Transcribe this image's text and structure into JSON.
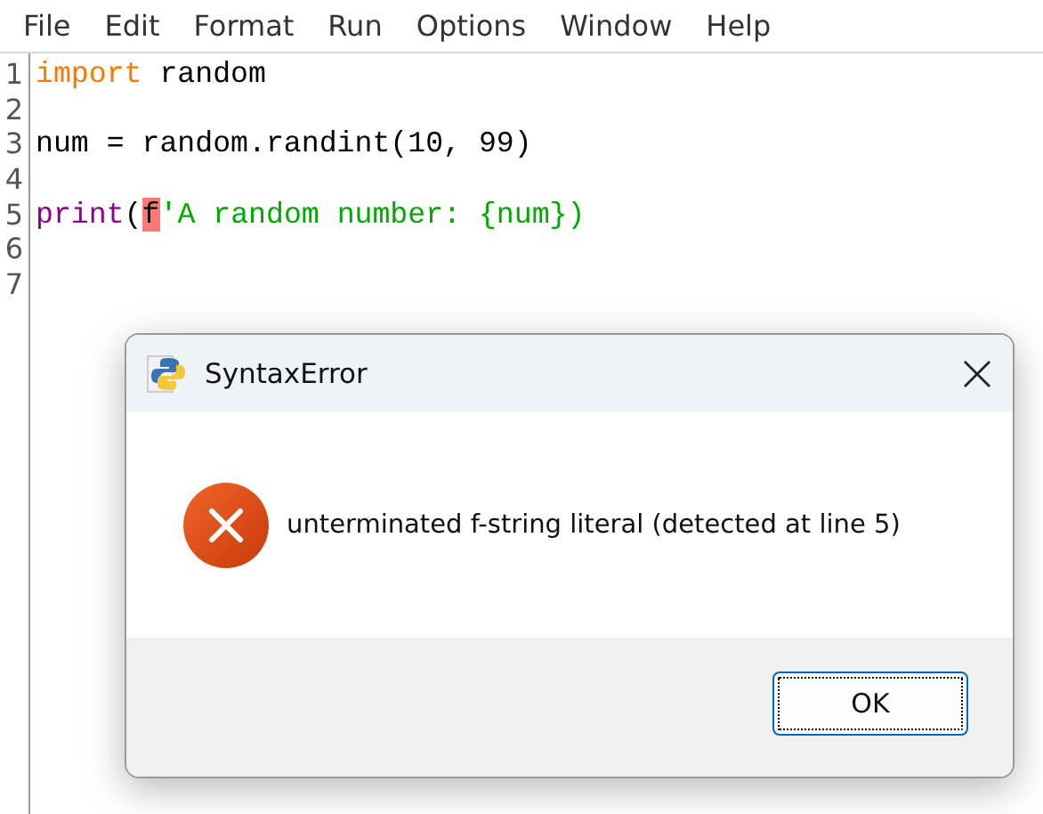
{
  "menu": [
    "File",
    "Edit",
    "Format",
    "Run",
    "Options",
    "Window",
    "Help"
  ],
  "editor": {
    "lines": [
      {
        "number": "1",
        "tokens": [
          {
            "text": "import",
            "kind": "keyword"
          },
          {
            "text": " random",
            "kind": "plain"
          }
        ]
      },
      {
        "number": "2"
      },
      {
        "number": "3",
        "tokens": [
          {
            "text": "num = random.randint(10, 99)",
            "kind": "plain"
          }
        ]
      },
      {
        "number": "4"
      },
      {
        "number": "5",
        "tokens": [
          {
            "text": "print",
            "kind": "builtin"
          },
          {
            "text": "(",
            "kind": "plain"
          },
          {
            "text": "f",
            "kind": "error"
          },
          {
            "text": "'A random number: {num})",
            "kind": "string"
          }
        ]
      },
      {
        "number": "6"
      },
      {
        "number": "7"
      }
    ]
  },
  "dialog": {
    "title": "SyntaxError",
    "message": "unterminated f-string literal (detected at line 5)",
    "buttons": [
      {
        "label": "OK",
        "focused": true
      }
    ]
  }
}
